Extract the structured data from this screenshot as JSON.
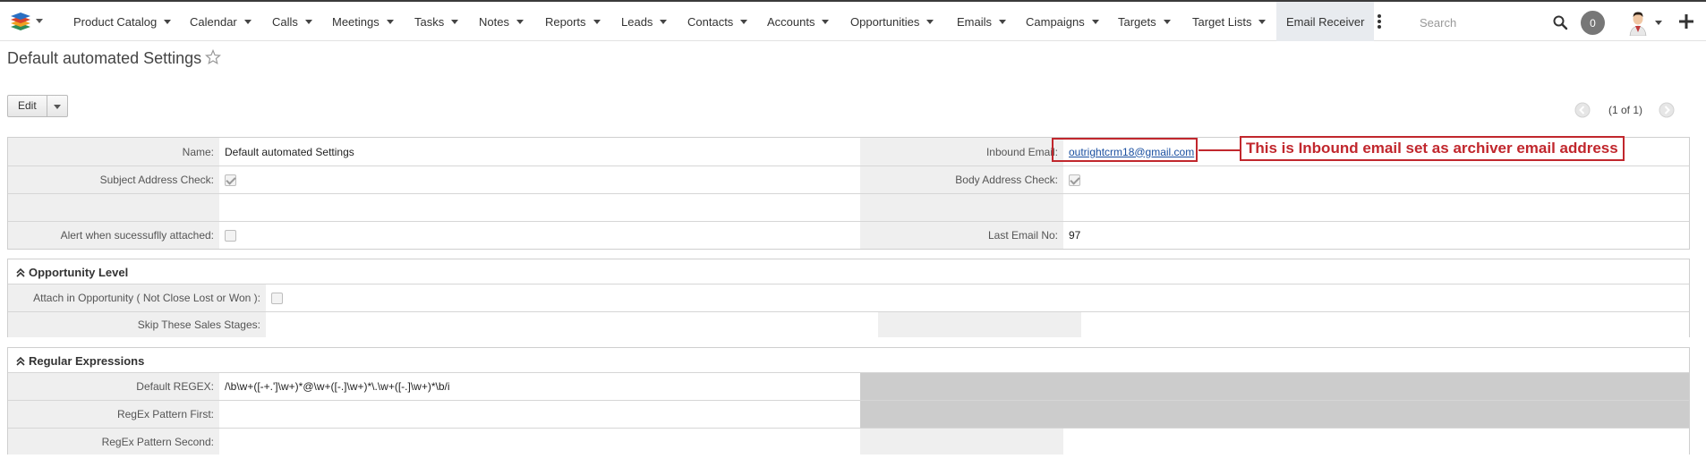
{
  "nav": {
    "items": [
      {
        "label": "Product Catalog",
        "left": 0
      },
      {
        "label": "Calendar"
      },
      {
        "label": "Calls"
      },
      {
        "label": "Meetings"
      },
      {
        "label": "Tasks"
      },
      {
        "label": "Notes"
      },
      {
        "label": "Reports"
      },
      {
        "label": "Leads"
      },
      {
        "label": "Contacts"
      },
      {
        "label": "Accounts"
      },
      {
        "label": "Opportunities"
      },
      {
        "label": "Emails"
      },
      {
        "label": "Campaigns"
      },
      {
        "label": "Targets"
      },
      {
        "label": "Target Lists"
      }
    ],
    "active_label": "Email Receiver",
    "search_placeholder": "Search",
    "notification_count": "0"
  },
  "page": {
    "title": "Default automated Settings",
    "edit_label": "Edit",
    "pager": "(1 of 1)"
  },
  "main": {
    "name_label": "Name:",
    "name_value": "Default automated Settings",
    "inbound_label": "Inbound Email:",
    "inbound_value": "outrightcrm18@gmail.com",
    "subject_label": "Subject Address Check:",
    "subject_checked": true,
    "body_label": "Body Address Check:",
    "body_checked": true,
    "alert_label": "Alert when sucessuflly attached:",
    "alert_checked": false,
    "last_email_label": "Last Email No:",
    "last_email_value": "97"
  },
  "opportunity": {
    "heading": "Opportunity Level",
    "attach_label": "Attach in Opportunity ( Not Close Lost or Won ):",
    "attach_checked": false,
    "skip_label": "Skip These Sales Stages:"
  },
  "regex": {
    "heading": "Regular Expressions",
    "default_label": "Default REGEX:",
    "default_value": "/\\b\\w+([-+.']\\w+)*@\\w+([-.]\\w+)*\\.\\w+([-.]\\w+)*\\b/i",
    "first_label": "RegEx Pattern First:",
    "second_label": "RegEx Pattern Second:"
  },
  "annotation": {
    "text": "This is Inbound email set as archiver email address",
    "color": "#c1272d"
  }
}
